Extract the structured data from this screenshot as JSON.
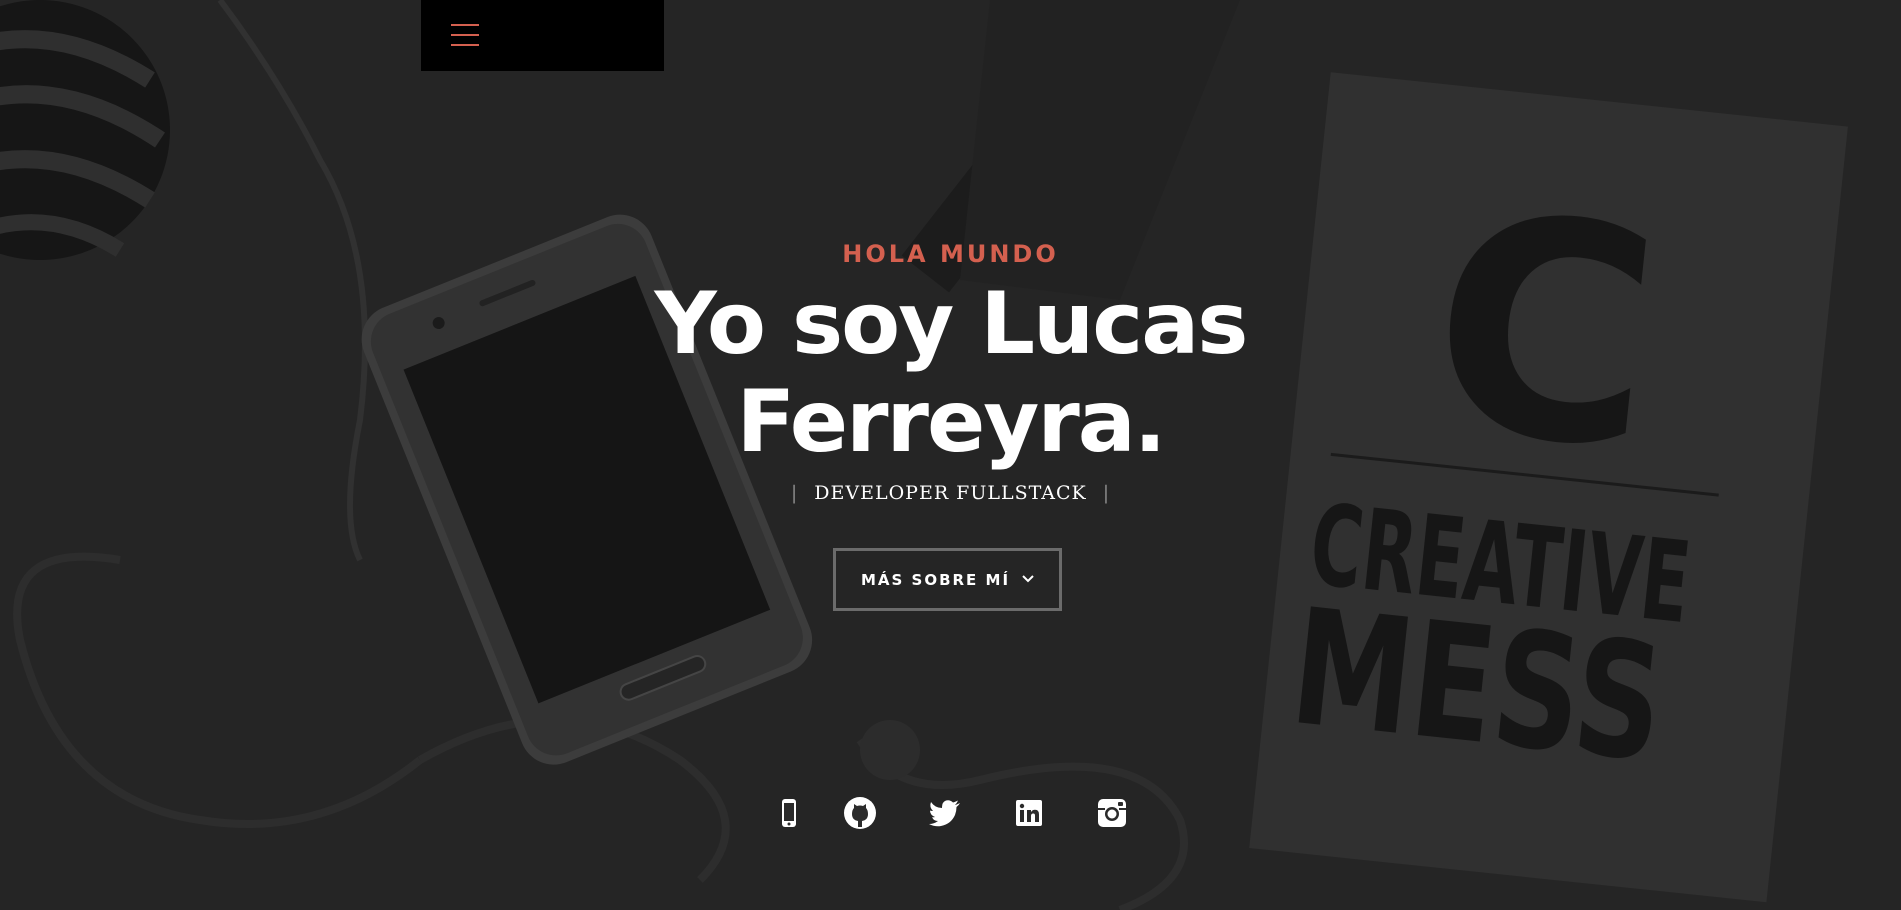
{
  "hero": {
    "kicker": "HOLA MUNDO",
    "title_line1": "Yo soy Lucas",
    "title_line2": "Ferreyra.",
    "subtitle": "DEVELOPER FULLSTACK",
    "subtitle_separator": "|",
    "cta_label": "MÁS SOBRE MÍ",
    "cta_icon": "chevron-down-icon"
  },
  "background": {
    "notebook_text_big": "C",
    "notebook_text_line1": "CREATIVE",
    "notebook_text_line2": "MESS"
  },
  "social": [
    {
      "icon": "phone-icon"
    },
    {
      "icon": "github-icon"
    },
    {
      "icon": "twitter-icon"
    },
    {
      "icon": "linkedin-icon"
    },
    {
      "icon": "instagram-icon"
    }
  ],
  "colors": {
    "accent": "#d4604f",
    "text": "#ffffff",
    "background": "#2b2b2b"
  }
}
